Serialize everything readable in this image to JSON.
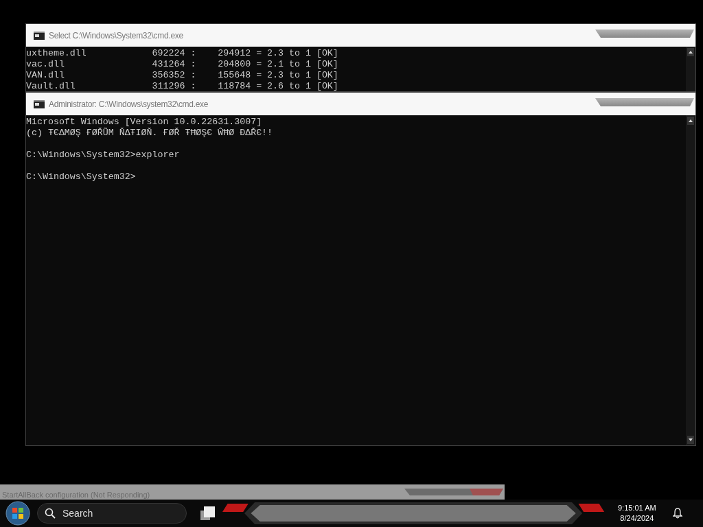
{
  "windows": [
    {
      "title": "Select C:\\Windows\\System32\\cmd.exe",
      "blocks": [
        [
          "uxtheme.dll            692224 :    294912 = 2.3 to 1 [OK]",
          "vac.dll                431264 :    204800 = 2.1 to 1 [OK]",
          "VAN.dll                356352 :    155648 = 2.3 to 1 [OK]",
          "Vault.dll              311296 :    118784 = 2.6 to 1 [OK]"
        ]
      ]
    },
    {
      "title": "Administrator: C:\\Windows\\system32\\cmd.exe",
      "blocks": [
        [
          "Microsoft Windows [Version 10.0.22631.3007]",
          "(c) ŦЄΔMØŞ ҒØŘŨM ŇΔŦIØŇ. ҒØŘ ŦĦØŞЄ ŴĦØ ĐΔŘЄ!!"
        ],
        [
          "C:\\Windows\\System32>explorer"
        ],
        [
          "C:\\Windows\\System32>"
        ]
      ]
    }
  ],
  "background_window": {
    "title": "StartAllBack configuration (Not Responding)"
  },
  "taskbar": {
    "search": {
      "placeholder": "Search"
    },
    "time": "9:15:01 AM",
    "date": "8/24/2024"
  }
}
